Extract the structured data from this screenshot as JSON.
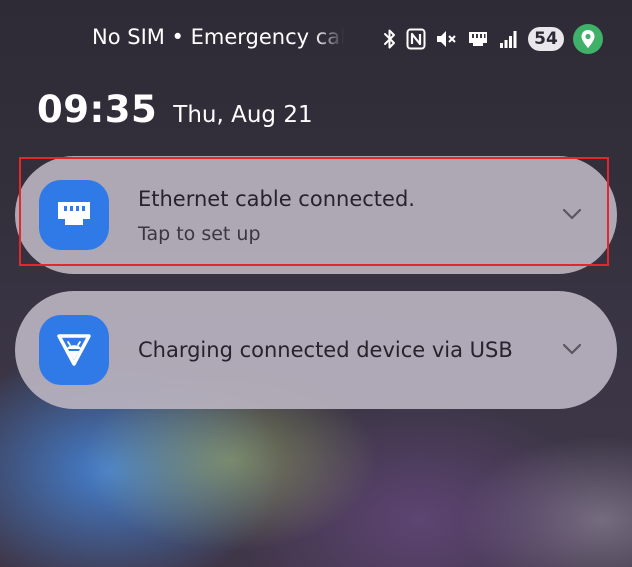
{
  "status_bar": {
    "carrier_text": "No SIM • Emergency calls only",
    "battery_level": "54",
    "icons": [
      "bluetooth-icon",
      "nfc-icon",
      "mute-icon",
      "ethernet-icon",
      "signal-icon",
      "battery-icon",
      "location-icon"
    ]
  },
  "lockscreen": {
    "time": "09:35",
    "date": "Thu, Aug 21"
  },
  "notifications": [
    {
      "icon": "ethernet-icon",
      "title": "Ethernet cable connected.",
      "subtitle": "Tap to set up"
    },
    {
      "icon": "android-system-icon",
      "title": "Charging connected device via USB"
    }
  ],
  "colors": {
    "app_icon_blue": "#2f7ae6",
    "notification_bg": "#b8b2be",
    "location_green": "#3fb168",
    "highlight_red": "#e0282d"
  }
}
